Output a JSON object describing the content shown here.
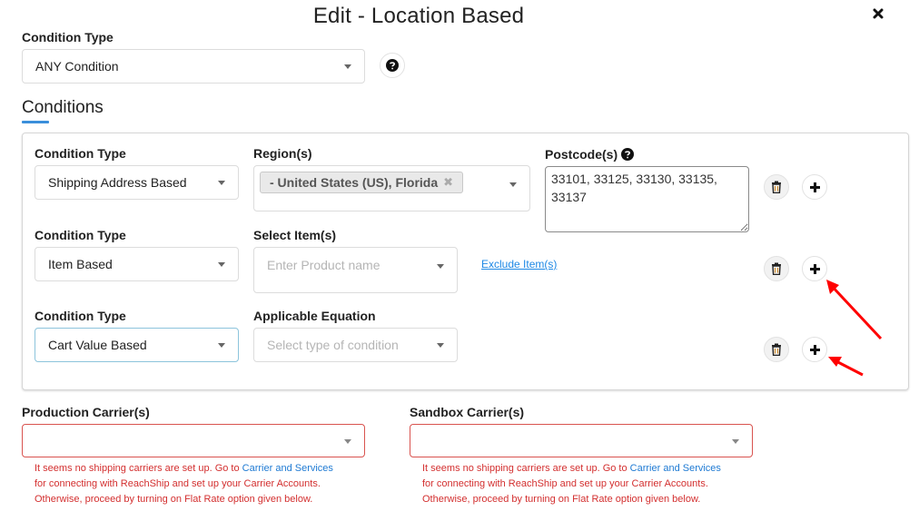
{
  "header": {
    "title": "Edit - Location Based",
    "close_icon": "close-icon"
  },
  "top_condition": {
    "label": "Condition Type",
    "value": "ANY Condition",
    "help_icon": "question-circle-icon"
  },
  "conditions": {
    "section_title": "Conditions",
    "accent_color": "#3a8fdb",
    "rows": [
      {
        "type_label": "Condition Type",
        "type_value": "Shipping Address Based",
        "field_label": "Region(s)",
        "region_tags": [
          "- United States (US), Florida"
        ],
        "postcode_label": "Postcode(s)",
        "postcode_value": "33101, 33125, 33130, 33135, 33137",
        "delete_icon": "trash-icon",
        "add_icon": "plus-icon"
      },
      {
        "type_label": "Condition Type",
        "type_value": "Item Based",
        "field_label": "Select Item(s)",
        "field_placeholder": "Enter Product name",
        "exclude_link": "Exclude Item(s)",
        "delete_icon": "trash-icon",
        "add_icon": "plus-icon"
      },
      {
        "type_label": "Condition Type",
        "type_value": "Cart Value Based",
        "field_label": "Applicable Equation",
        "field_placeholder": "Select type of condition",
        "delete_icon": "trash-icon",
        "add_icon": "plus-icon"
      }
    ]
  },
  "carriers": {
    "production": {
      "label": "Production Carrier(s)",
      "value": "",
      "error_part1": "It seems no shipping carriers are set up. Go to ",
      "error_link": "Carrier and Services",
      "error_line2": "for connecting with ReachShip and set up your Carrier Accounts.",
      "error_line3": "Otherwise, proceed by turning on Flat Rate option given below."
    },
    "sandbox": {
      "label": "Sandbox Carrier(s)",
      "value": "",
      "error_part1": "It seems no shipping carriers are set up. Go to ",
      "error_link": "Carrier and Services",
      "error_line2": "for connecting with ReachShip and set up your Carrier Accounts.",
      "error_line3": "Otherwise, proceed by turning on Flat Rate option given below."
    },
    "error_color": "#d32f2f"
  },
  "annotations": {
    "arrow_color": "#ff0000"
  }
}
